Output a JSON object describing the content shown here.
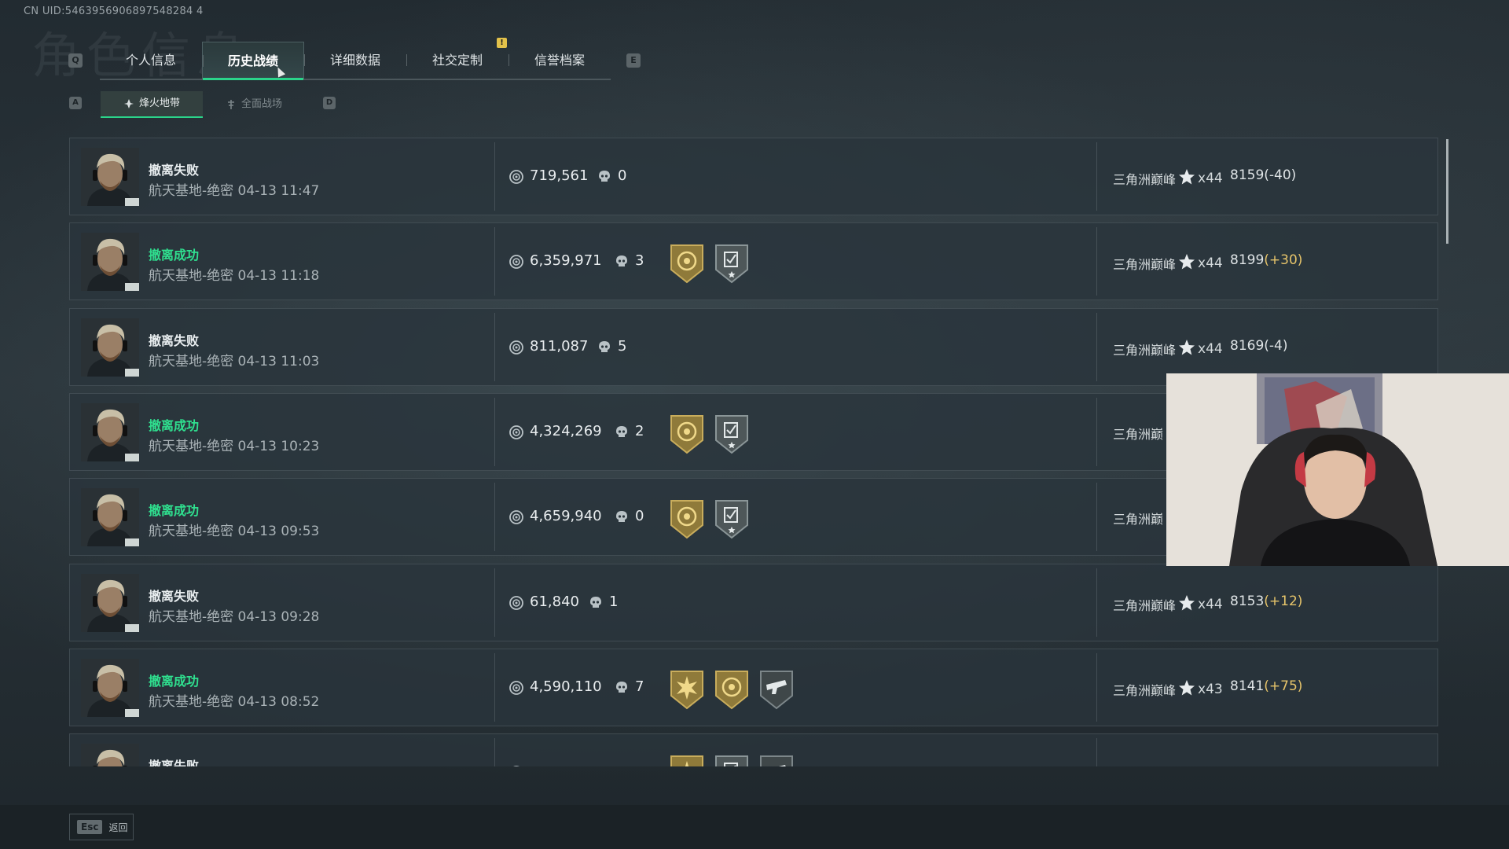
{
  "uid": "CN UID:5463956906897548284 4",
  "background_title": "角色信息",
  "keys": {
    "prev_tab": "Q",
    "next_tab": "E",
    "prev_subtab": "A",
    "next_subtab": "D"
  },
  "tabs": [
    {
      "label": "个人信息",
      "active": false
    },
    {
      "label": "历史战绩",
      "active": true
    },
    {
      "label": "详细数据",
      "active": false
    },
    {
      "label": "社交定制",
      "active": false
    },
    {
      "label": "信誉档案",
      "active": false
    }
  ],
  "alert_badge": "!",
  "subtabs": [
    {
      "label": "烽火地带",
      "active": true
    },
    {
      "label": "全面战场",
      "active": false
    }
  ],
  "records": [
    {
      "status": "撤离失败",
      "success": false,
      "meta": "航天基地-绝密 04-13 11:47",
      "value": "719,561",
      "kills": "0",
      "medals": [],
      "rank": "三角洲巅峰",
      "stars": "x44",
      "score": "8159",
      "delta": "(-40)",
      "delta_positive": false
    },
    {
      "status": "撤离成功",
      "success": true,
      "meta": "航天基地-绝密 04-13 11:18",
      "value": "6,359,971",
      "kills": "3",
      "medals": [
        "gold-coin-medal",
        "silver-check-medal"
      ],
      "rank": "三角洲巅峰",
      "stars": "x44",
      "score": "8199",
      "delta": "(+30)",
      "delta_positive": true
    },
    {
      "status": "撤离失败",
      "success": false,
      "meta": "航天基地-绝密 04-13 11:03",
      "value": "811,087",
      "kills": "5",
      "medals": [],
      "rank": "三角洲巅峰",
      "stars": "x44",
      "score": "8169",
      "delta": "(-4)",
      "delta_positive": false
    },
    {
      "status": "撤离成功",
      "success": true,
      "meta": "航天基地-绝密 04-13 10:23",
      "value": "4,324,269",
      "kills": "2",
      "medals": [
        "gold-coin-medal",
        "silver-check-medal"
      ],
      "rank": "三角洲巅",
      "stars": "",
      "score": "",
      "delta": "",
      "delta_positive": false
    },
    {
      "status": "撤离成功",
      "success": true,
      "meta": "航天基地-绝密 04-13 09:53",
      "value": "4,659,940",
      "kills": "0",
      "medals": [
        "gold-coin-medal",
        "silver-check-medal"
      ],
      "rank": "三角洲巅",
      "stars": "",
      "score": "",
      "delta": "",
      "delta_positive": false
    },
    {
      "status": "撤离失败",
      "success": false,
      "meta": "航天基地-绝密 04-13 09:28",
      "value": "61,840",
      "kills": "1",
      "medals": [],
      "rank": "三角洲巅峰",
      "stars": "x44",
      "score": "8153",
      "delta": "(+12)",
      "delta_positive": true
    },
    {
      "status": "撤离成功",
      "success": true,
      "meta": "航天基地-绝密 04-13 08:52",
      "value": "4,590,110",
      "kills": "7",
      "medals": [
        "gold-burst-medal",
        "gold-coin-medal",
        "silver-gun-medal"
      ],
      "rank": "三角洲巅峰",
      "stars": "x43",
      "score": "8141",
      "delta": "(+75)",
      "delta_positive": true
    },
    {
      "status": "撤离失败",
      "success": false,
      "meta": "",
      "value": "",
      "kills": "",
      "medals": [
        "gold-burst-medal",
        "silver-check-medal",
        "silver-gun-medal"
      ],
      "rank": "",
      "stars": "",
      "score": "",
      "delta": "",
      "delta_positive": false
    }
  ],
  "footer": {
    "esc_key": "Esc",
    "back_label": "返回"
  },
  "colors": {
    "accent": "#2bd48a",
    "success": "#2fe08f",
    "delta_positive": "#e6c46a",
    "gold_medal": "#b59a4a",
    "silver_medal": "#6f7a7d"
  }
}
